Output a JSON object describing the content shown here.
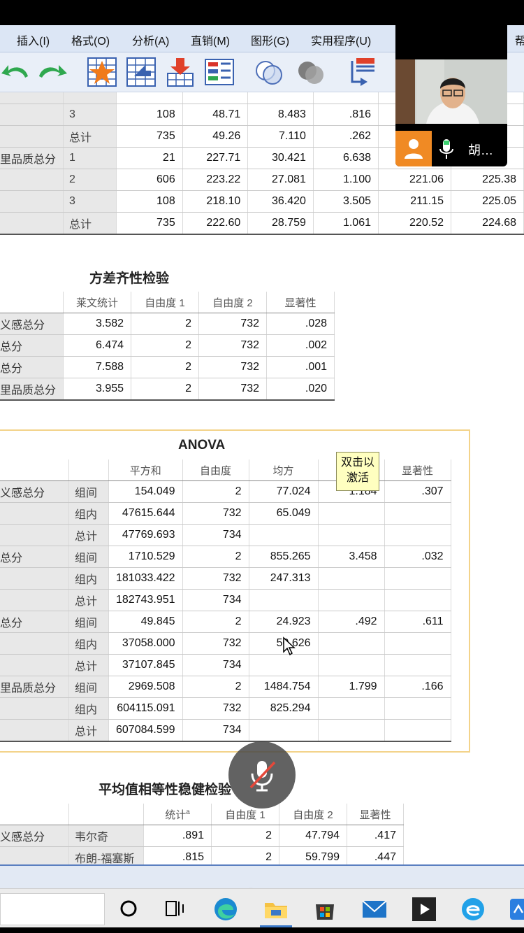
{
  "menu": [
    "插入(I)",
    "格式(O)",
    "分析(A)",
    "直销(M)",
    "图形(G)",
    "实用程序(U)",
    "帮"
  ],
  "desc_table": {
    "rows": [
      {
        "group": "",
        "label": "3",
        "cells": [
          "108",
          "48.71",
          "8.483",
          ".816",
          "",
          ""
        ]
      },
      {
        "group": "",
        "label": "总计",
        "cells": [
          "735",
          "49.26",
          "7.110",
          ".262",
          "",
          ""
        ]
      },
      {
        "group": "里品质总分",
        "label": "1",
        "cells": [
          "21",
          "227.71",
          "30.421",
          "6.638",
          "",
          ""
        ]
      },
      {
        "group": "",
        "label": "2",
        "cells": [
          "606",
          "223.22",
          "27.081",
          "1.100",
          "221.06",
          "225.38"
        ]
      },
      {
        "group": "",
        "label": "3",
        "cells": [
          "108",
          "218.10",
          "36.420",
          "3.505",
          "211.15",
          "225.05"
        ]
      },
      {
        "group": "",
        "label": "总计",
        "cells": [
          "735",
          "222.60",
          "28.759",
          "1.061",
          "220.52",
          "224.68"
        ]
      }
    ]
  },
  "levene": {
    "title": "方差齐性检验",
    "headers": [
      "莱文统计",
      "自由度 1",
      "自由度 2",
      "显著性"
    ],
    "rows": [
      {
        "label": "义感总分",
        "cells": [
          "3.582",
          "2",
          "732",
          ".028"
        ]
      },
      {
        "label": "总分",
        "cells": [
          "6.474",
          "2",
          "732",
          ".002"
        ]
      },
      {
        "label": "总分",
        "cells": [
          "7.588",
          "2",
          "732",
          ".001"
        ]
      },
      {
        "label": "里品质总分",
        "cells": [
          "3.955",
          "2",
          "732",
          ".020"
        ]
      }
    ]
  },
  "anova": {
    "title": "ANOVA",
    "headers": [
      "平方和",
      "自由度",
      "均方",
      "F",
      "显著性"
    ],
    "groups": [
      {
        "label": "义感总分",
        "rows": [
          {
            "label": "组间",
            "cells": [
              "154.049",
              "2",
              "77.024",
              "1.184",
              ".307"
            ]
          },
          {
            "label": "组内",
            "cells": [
              "47615.644",
              "732",
              "65.049",
              "",
              ""
            ]
          },
          {
            "label": "总计",
            "cells": [
              "47769.693",
              "734",
              "",
              "",
              ""
            ]
          }
        ]
      },
      {
        "label": "总分",
        "rows": [
          {
            "label": "组间",
            "cells": [
              "1710.529",
              "2",
              "855.265",
              "3.458",
              ".032"
            ]
          },
          {
            "label": "组内",
            "cells": [
              "181033.422",
              "732",
              "247.313",
              "",
              ""
            ]
          },
          {
            "label": "总计",
            "cells": [
              "182743.951",
              "734",
              "",
              "",
              ""
            ]
          }
        ]
      },
      {
        "label": "总分",
        "rows": [
          {
            "label": "组间",
            "cells": [
              "49.845",
              "2",
              "24.923",
              ".492",
              ".611"
            ]
          },
          {
            "label": "组内",
            "cells": [
              "37058.000",
              "732",
              "50.626",
              "",
              ""
            ]
          },
          {
            "label": "总计",
            "cells": [
              "37107.845",
              "734",
              "",
              "",
              ""
            ]
          }
        ]
      },
      {
        "label": "里品质总分",
        "rows": [
          {
            "label": "组间",
            "cells": [
              "2969.508",
              "2",
              "1484.754",
              "1.799",
              ".166"
            ]
          },
          {
            "label": "组内",
            "cells": [
              "604115.091",
              "732",
              "825.294",
              "",
              ""
            ]
          },
          {
            "label": "总计",
            "cells": [
              "607084.599",
              "734",
              "",
              "",
              ""
            ]
          }
        ]
      }
    ],
    "tooltip": "双击以\n激活"
  },
  "robust": {
    "title": "平均值相等性稳健检验",
    "headers": [
      "统计",
      "自由度 1",
      "自由度 2",
      "显著性"
    ],
    "header_sup": "a",
    "rows": [
      {
        "group": "义感总分",
        "label": "韦尔奇",
        "cells": [
          ".891",
          "2",
          "47.794",
          ".417"
        ]
      },
      {
        "group": "",
        "label": "布朗-福塞斯",
        "cells": [
          ".815",
          "2",
          "59.799",
          ".447"
        ]
      }
    ]
  },
  "video": {
    "name": "胡…"
  },
  "colors": {
    "menubar": "#dce6f5",
    "accent_orange": "#f08a24",
    "anova_border": "#f3d38a",
    "tooltip_bg": "#ffffc0"
  }
}
